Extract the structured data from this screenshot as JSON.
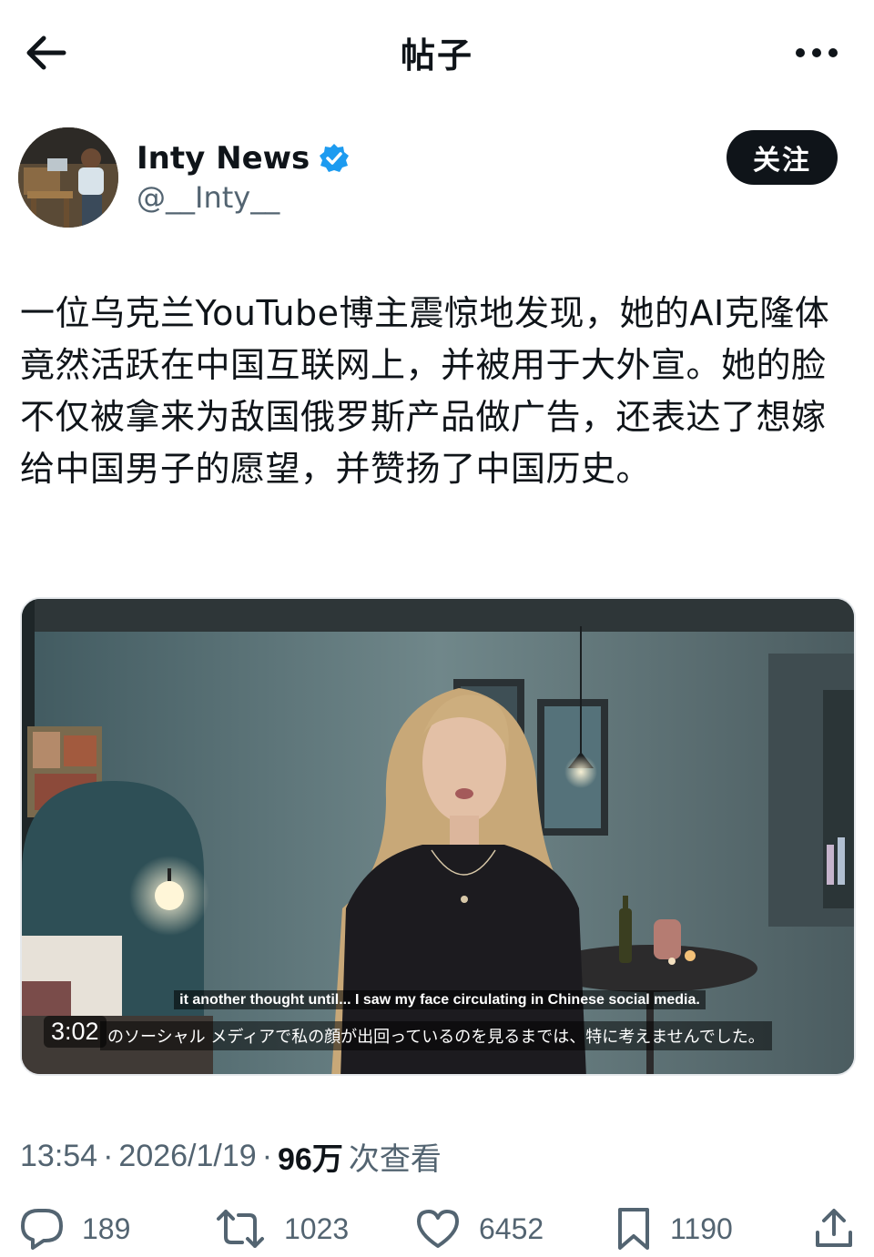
{
  "header": {
    "title": "帖子",
    "back_icon": "arrow-left-icon",
    "more_icon": "more-horizontal-icon"
  },
  "author": {
    "display_name": "Inty News",
    "handle": "@__Inty__",
    "verified": true,
    "verified_color": "#1d9bf0",
    "follow_label": "关注"
  },
  "post": {
    "text": "一位乌克兰YouTube博主震惊地发现，她的AI克隆体竟然活跃在中国互联网上，并被用于大外宣。她的脸不仅被拿来为敌国俄罗斯产品做广告，还表达了想嫁给中国男子的愿望，并赞扬了中国历史。"
  },
  "video": {
    "duration": "3:02",
    "subtitle_en": "it another thought until... I saw my face circulating in Chinese social media.",
    "subtitle_ja": "のソーシャル メディアで私の顔が出回っているのを見るまでは、特に考えませんでした。"
  },
  "meta": {
    "time": "13:54",
    "date": "2026/1/19",
    "separator": "·",
    "views": "96万",
    "views_label": "次查看"
  },
  "actions": {
    "replies": "189",
    "reposts": "1023",
    "likes": "6452",
    "bookmarks": "1190"
  }
}
